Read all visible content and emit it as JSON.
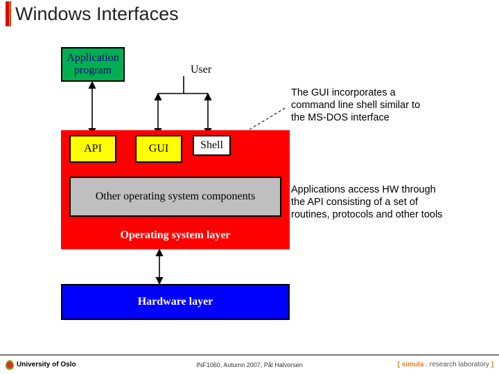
{
  "title": "Windows Interfaces",
  "diagram": {
    "app_label": "Application\nprogram",
    "user_label": "User",
    "api_label": "API",
    "gui_label": "GUI",
    "shell_label": "Shell",
    "other_label": "Other operating system components",
    "os_label": "Operating system layer",
    "hw_label": "Hardware layer"
  },
  "notes": {
    "gui_note": "The GUI incorporates a command line shell similar to the MS-DOS interface",
    "api_note": "Applications access HW through the API consisting of a set of routines, protocols and other tools"
  },
  "footer": {
    "left": "University of Oslo",
    "center": "INF1060, Autumn 2007, Pål Halvorsen",
    "right_bracket_open": "[ ",
    "right_simula": "simula",
    "right_dot": " . ",
    "right_research": "research laboratory",
    "right_bracket_close": " ]"
  },
  "colors": {
    "green": "#00b050",
    "yellow": "#ffff00",
    "grey": "#bfbfbf",
    "red": "#ff0000",
    "blue": "#0000ff"
  }
}
